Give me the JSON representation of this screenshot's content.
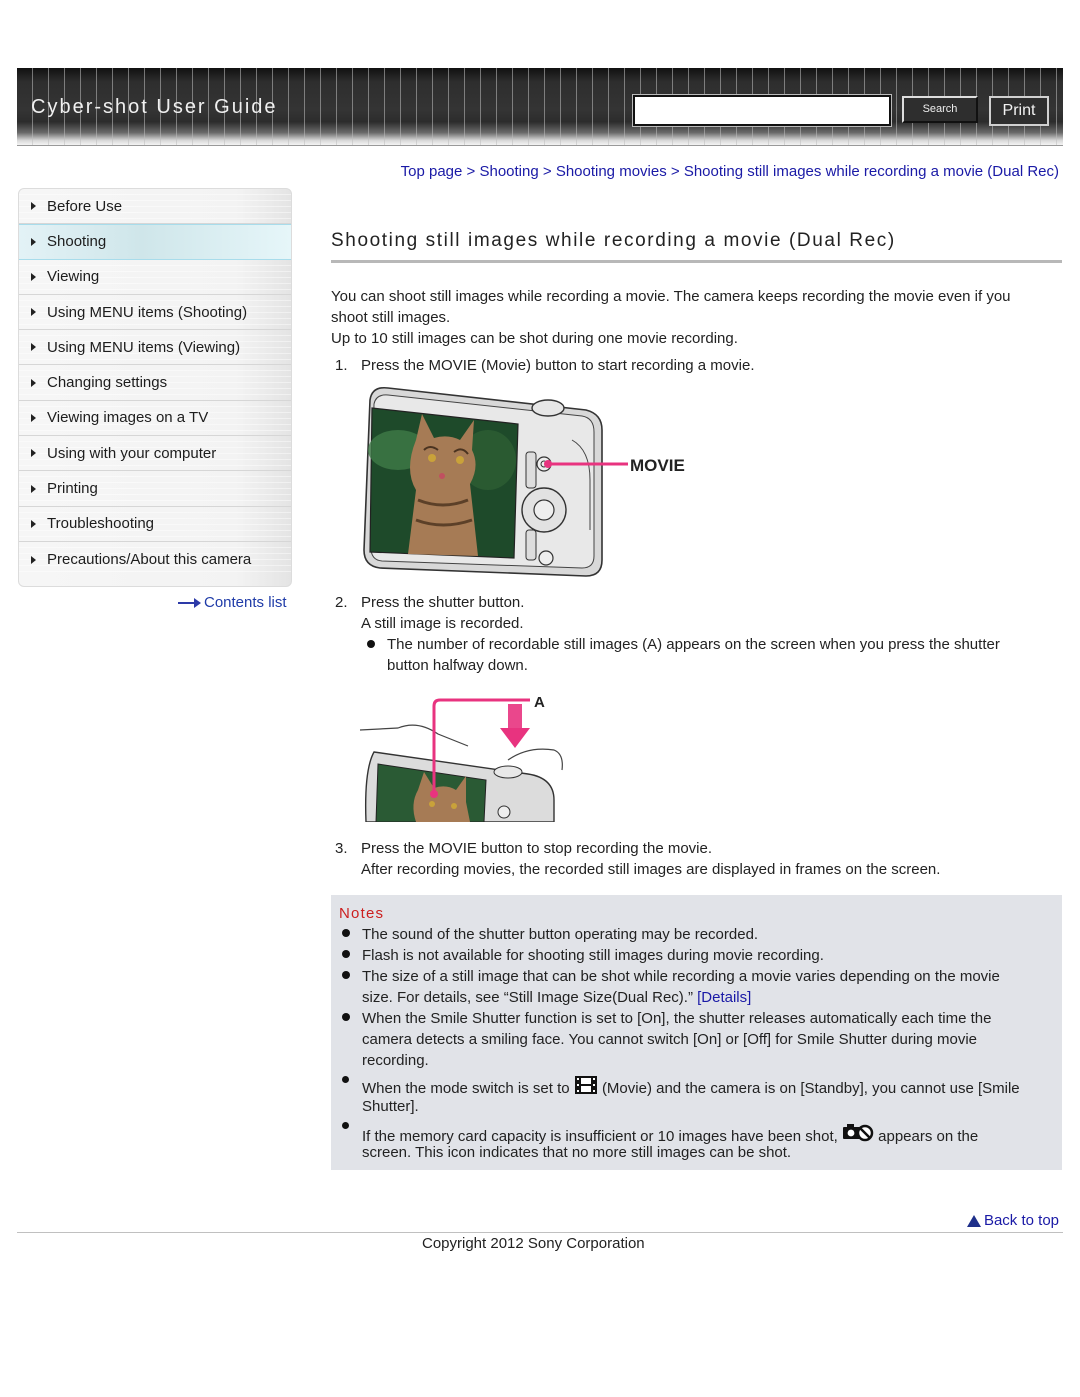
{
  "header": {
    "title": "Cyber-shot User Guide",
    "search_value": "",
    "search_button": "Search",
    "print_button": "Print"
  },
  "sidebar": {
    "items": [
      {
        "label": "Before Use",
        "active": false
      },
      {
        "label": "Shooting",
        "active": true
      },
      {
        "label": "Viewing",
        "active": false
      },
      {
        "label": "Using MENU items (Shooting)",
        "active": false
      },
      {
        "label": "Using MENU items (Viewing)",
        "active": false
      },
      {
        "label": "Changing settings",
        "active": false
      },
      {
        "label": "Viewing images on a TV",
        "active": false
      },
      {
        "label": "Using with your computer",
        "active": false
      },
      {
        "label": "Printing",
        "active": false
      },
      {
        "label": "Troubleshooting",
        "active": false
      },
      {
        "label": "Precautions/About this camera",
        "active": false
      }
    ],
    "contents_link": "Contents list"
  },
  "breadcrumb": {
    "items": [
      "Top page",
      "Shooting",
      "Shooting movies",
      "Shooting still images while recording a movie (Dual Rec)"
    ],
    "separator": " > "
  },
  "main": {
    "title": "Shooting still images while recording a movie (Dual Rec)",
    "intro_1": "You can shoot still images while recording a movie. The camera keeps recording the movie even if you",
    "intro_1b": "shoot still images.",
    "intro_2": "Up to 10 still images can be shot during one movie recording.",
    "steps": [
      {
        "num": "1.",
        "text": "Press the MOVIE (Movie) button to start recording a movie."
      },
      {
        "num": "2.",
        "text": "Press the shutter button.",
        "sub": "A still image is recorded.",
        "bullet_1": "The number of recordable still images (A) appears on the screen when you press the shutter",
        "bullet_1b": "button halfway down."
      },
      {
        "num": "3.",
        "text": "Press the MOVIE button to stop recording the movie.",
        "sub": "After recording movies, the recorded still images are displayed in frames on the screen."
      }
    ],
    "figure_1_label": "MOVIE",
    "figure_2_label": "A"
  },
  "notes": {
    "title": "Notes",
    "items": [
      {
        "l1": "The sound of the shutter button operating may be recorded."
      },
      {
        "l1": "Flash is not available for shooting still images during movie recording."
      },
      {
        "l1": "The size of a still image that can be shot while recording a movie varies depending on the movie",
        "l2": "size. For details, see “Still Image Size(Dual Rec).”",
        "link": "[Details]"
      },
      {
        "l1": "When the Smile Shutter function is set to [On], the shutter releases automatically each time the",
        "l2": "camera detects a smiling face. You cannot switch [On] or [Off] for Smile Shutter during movie",
        "l3": "recording."
      },
      {
        "l1a": "When the mode switch is set to",
        "icon": "movie-mode-icon",
        "l1b": "(Movie) and the camera is on [Standby], you cannot use [Smile",
        "l2": "Shutter]."
      },
      {
        "l1a": "If the memory card capacity is insufficient or 10 images have been shot,",
        "icon": "no-still-image-icon",
        "l1b": "appears on the",
        "l2": "screen. This icon indicates that no more still images can be shot."
      }
    ]
  },
  "footer": {
    "back_to_top": "Back to top",
    "copyright": "Copyright 2012 Sony Corporation"
  },
  "colors": {
    "link": "#1a1aa6",
    "notes_title": "#cc1f1f",
    "notes_bg": "#e1e3e8",
    "callout": "#e8337f",
    "active_nav": "#cfe6ea"
  }
}
